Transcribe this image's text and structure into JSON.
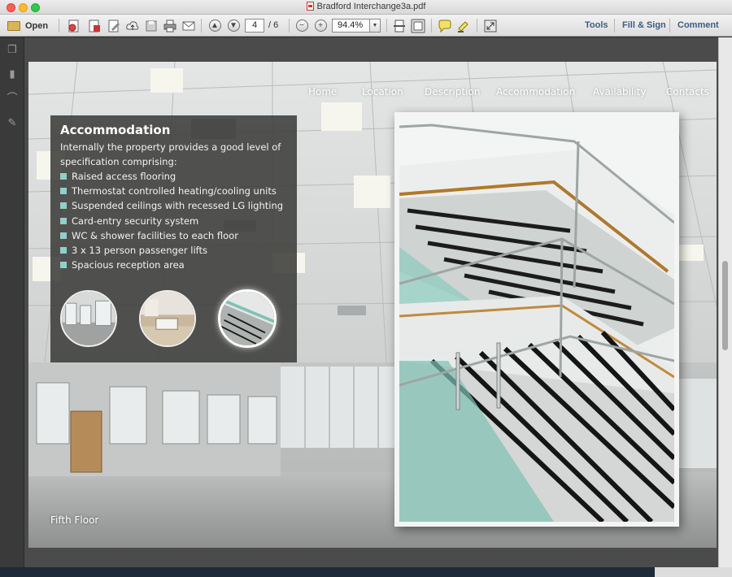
{
  "window": {
    "title": "Bradford Interchange3a.pdf"
  },
  "toolbar": {
    "open_label": "Open",
    "current_page": "4",
    "page_total": "/ 6",
    "zoom": "94.4%",
    "tools_label": "Tools",
    "fill_sign_label": "Fill & Sign",
    "comment_label": "Comment"
  },
  "document": {
    "nav": [
      "Home",
      "Location",
      "Description",
      "Accommodation",
      "Availability",
      "Contacts"
    ],
    "section_title": "Accommodation",
    "intro": "Internally the property provides a good level of specification comprising:",
    "features": [
      "Raised access flooring",
      "Thermostat controlled heating/cooling units",
      "Suspended ceilings with recessed LG lighting",
      "Card-entry security system",
      "WC & shower facilities to each floor",
      "3 x 13 person passenger lifts",
      "Spacious reception area"
    ],
    "floor_label": "Fifth Floor",
    "accent_color": "#8fd0c8"
  }
}
